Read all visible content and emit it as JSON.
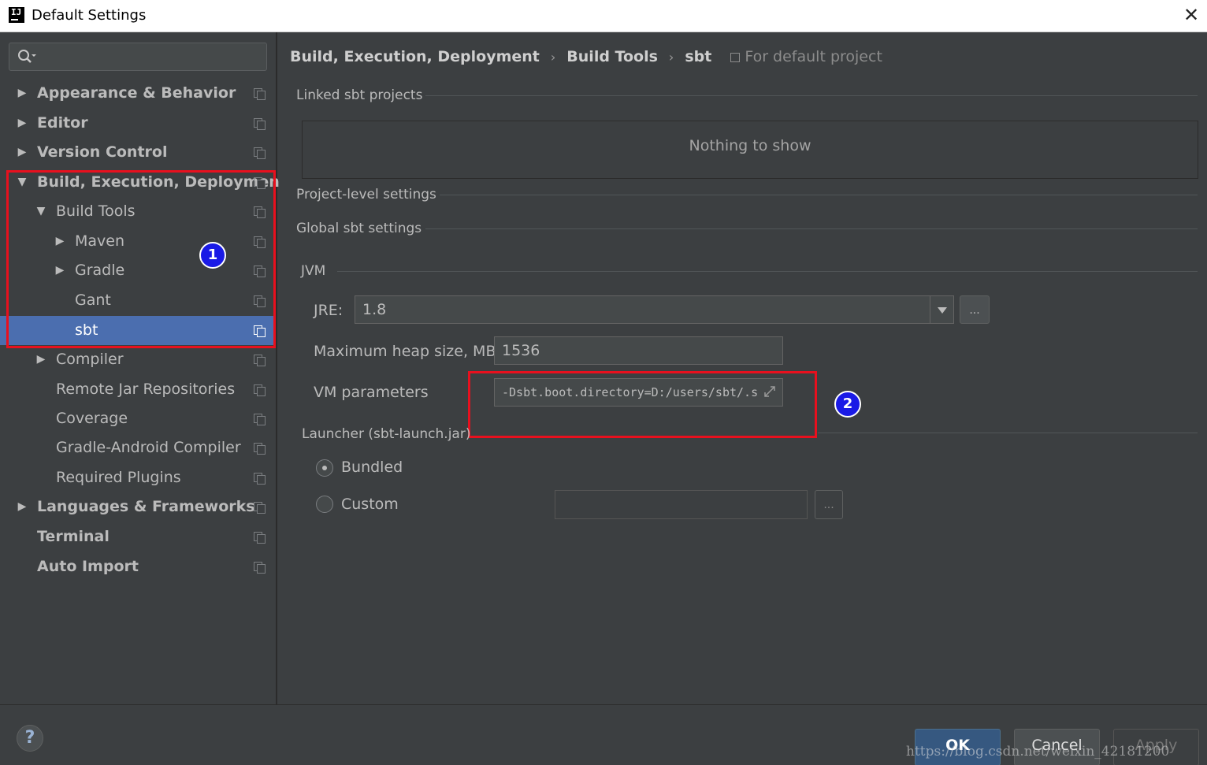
{
  "window": {
    "title": "Default Settings",
    "app_icon": "IJ"
  },
  "sidebar": {
    "search_placeholder": "",
    "items": [
      {
        "label": "Appearance & Behavior",
        "expanded": false
      },
      {
        "label": "Editor",
        "expanded": false
      },
      {
        "label": "Version Control",
        "expanded": false
      },
      {
        "label": "Build, Execution, Deployment",
        "expanded": true
      },
      {
        "label": "Build Tools",
        "expanded": true
      },
      {
        "label": "Maven",
        "expanded": false
      },
      {
        "label": "Gradle",
        "expanded": false
      },
      {
        "label": "Gant"
      },
      {
        "label": "sbt",
        "selected": true
      },
      {
        "label": "Compiler",
        "expanded": false
      },
      {
        "label": "Remote Jar Repositories"
      },
      {
        "label": "Coverage"
      },
      {
        "label": "Gradle-Android Compiler"
      },
      {
        "label": "Required Plugins"
      },
      {
        "label": "Languages & Frameworks",
        "expanded": false
      },
      {
        "label": "Terminal"
      },
      {
        "label": "Auto Import"
      }
    ]
  },
  "breadcrumb": {
    "items": [
      "Build, Execution, Deployment",
      "Build Tools",
      "sbt"
    ],
    "separator": "›",
    "scope": "For default project"
  },
  "content": {
    "linked_projects_title": "Linked sbt projects",
    "empty_text": "Nothing to show",
    "project_level_title": "Project-level settings",
    "global_title": "Global sbt settings",
    "jvm_title": "JVM",
    "jre_label": "JRE:",
    "jre_value": "1.8",
    "heap_label": "Maximum heap size, MB",
    "heap_value": "1536",
    "vm_label": "VM parameters",
    "vm_value": "-Dsbt.boot.directory=D:/users/sbt/.s",
    "launcher_title": "Launcher (sbt-launch.jar)",
    "bundled_label": "Bundled",
    "custom_label": "Custom",
    "custom_path": "",
    "ellipsis": "..."
  },
  "annotations": {
    "badge1": "1",
    "badge2": "2",
    "color": "#e8101e"
  },
  "footer": {
    "help": "?",
    "ok": "OK",
    "cancel": "Cancel",
    "apply": "Apply",
    "watermark": "https://blog.csdn.net/weixin_42181200"
  },
  "colors": {
    "selection": "#4b6eaf",
    "background": "#3c3f41",
    "ok_button": "#365880"
  }
}
